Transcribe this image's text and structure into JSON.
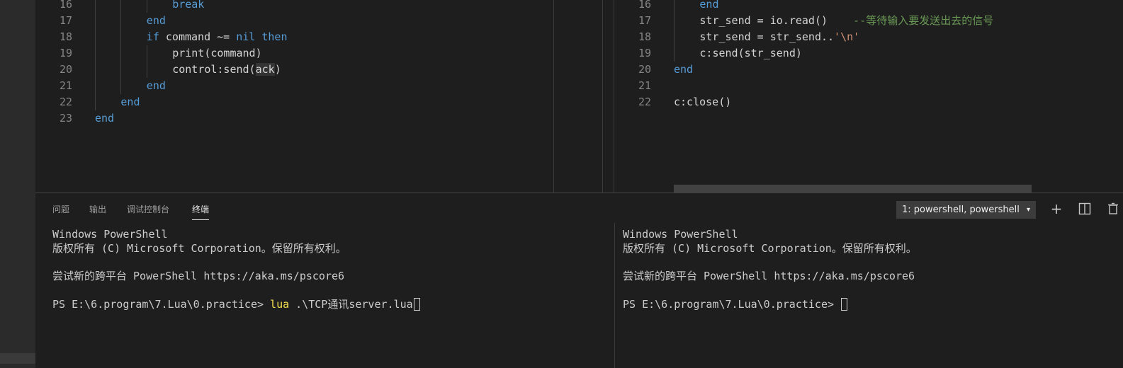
{
  "left_editor": {
    "lines": [
      {
        "n": "16",
        "parts": [
          {
            "t": "break",
            "c": "kw"
          }
        ]
      },
      {
        "n": "17",
        "parts": [
          {
            "t": "end",
            "c": "kw"
          }
        ]
      },
      {
        "n": "18",
        "parts": [
          {
            "t": "if",
            "c": "kw"
          },
          {
            "t": " command ~= ",
            "c": ""
          },
          {
            "t": "nil",
            "c": "kw"
          },
          {
            "t": " ",
            "c": ""
          },
          {
            "t": "then",
            "c": "kw"
          }
        ]
      },
      {
        "n": "19",
        "parts": [
          {
            "t": "print(command)",
            "c": ""
          }
        ]
      },
      {
        "n": "20",
        "parts": [
          {
            "t": "control:send(",
            "c": ""
          },
          {
            "t": "ack",
            "c": "hl"
          },
          {
            "t": ")",
            "c": ""
          }
        ]
      },
      {
        "n": "21",
        "parts": [
          {
            "t": "end",
            "c": "kw"
          }
        ]
      },
      {
        "n": "22",
        "parts": [
          {
            "t": "end",
            "c": "kw"
          }
        ]
      },
      {
        "n": "23",
        "parts": [
          {
            "t": "end",
            "c": "kw"
          }
        ]
      }
    ]
  },
  "right_editor": {
    "lines": [
      {
        "n": "16",
        "parts": [
          {
            "t": "end",
            "c": "kw"
          }
        ]
      },
      {
        "n": "17",
        "parts": [
          {
            "t": "str_send = io.read()    ",
            "c": ""
          },
          {
            "t": "--等待输入要发送出去的信号",
            "c": "cmt"
          }
        ]
      },
      {
        "n": "18",
        "parts": [
          {
            "t": "str_send = str_send..",
            "c": ""
          },
          {
            "t": "'\\n'",
            "c": "str"
          }
        ]
      },
      {
        "n": "19",
        "parts": [
          {
            "t": "c:send(str_send)",
            "c": ""
          }
        ]
      },
      {
        "n": "20",
        "parts": [
          {
            "t": "end",
            "c": "kw"
          }
        ]
      },
      {
        "n": "21",
        "parts": []
      },
      {
        "n": "22",
        "parts": [
          {
            "t": "c:close()",
            "c": ""
          }
        ]
      }
    ]
  },
  "panel": {
    "tabs": [
      {
        "label": "问题",
        "active": false
      },
      {
        "label": "输出",
        "active": false
      },
      {
        "label": "调试控制台",
        "active": false
      },
      {
        "label": "终端",
        "active": true
      }
    ],
    "terminal_select": "1: powershell, powershell",
    "add_icon": "+",
    "split_icon": "split-icon",
    "trash_icon": "trash-icon"
  },
  "terminal_left": {
    "lines": [
      "Windows PowerShell",
      "版权所有 (C) Microsoft Corporation。保留所有权利。",
      "",
      "尝试新的跨平台 PowerShell https://aka.ms/pscore6",
      ""
    ],
    "prompt": "PS E:\\6.program\\7.Lua\\0.practice> ",
    "command": "lua",
    "args": " .\\TCP通讯server.lua"
  },
  "terminal_right": {
    "lines": [
      "Windows PowerShell",
      "版权所有 (C) Microsoft Corporation。保留所有权利。",
      "",
      "尝试新的跨平台 PowerShell https://aka.ms/pscore6",
      ""
    ],
    "prompt": "PS E:\\6.program\\7.Lua\\0.practice> "
  },
  "colors": {
    "keyword": "#569cd6",
    "string": "#ce9178",
    "comment": "#6a9955",
    "command": "#f5e04d"
  }
}
